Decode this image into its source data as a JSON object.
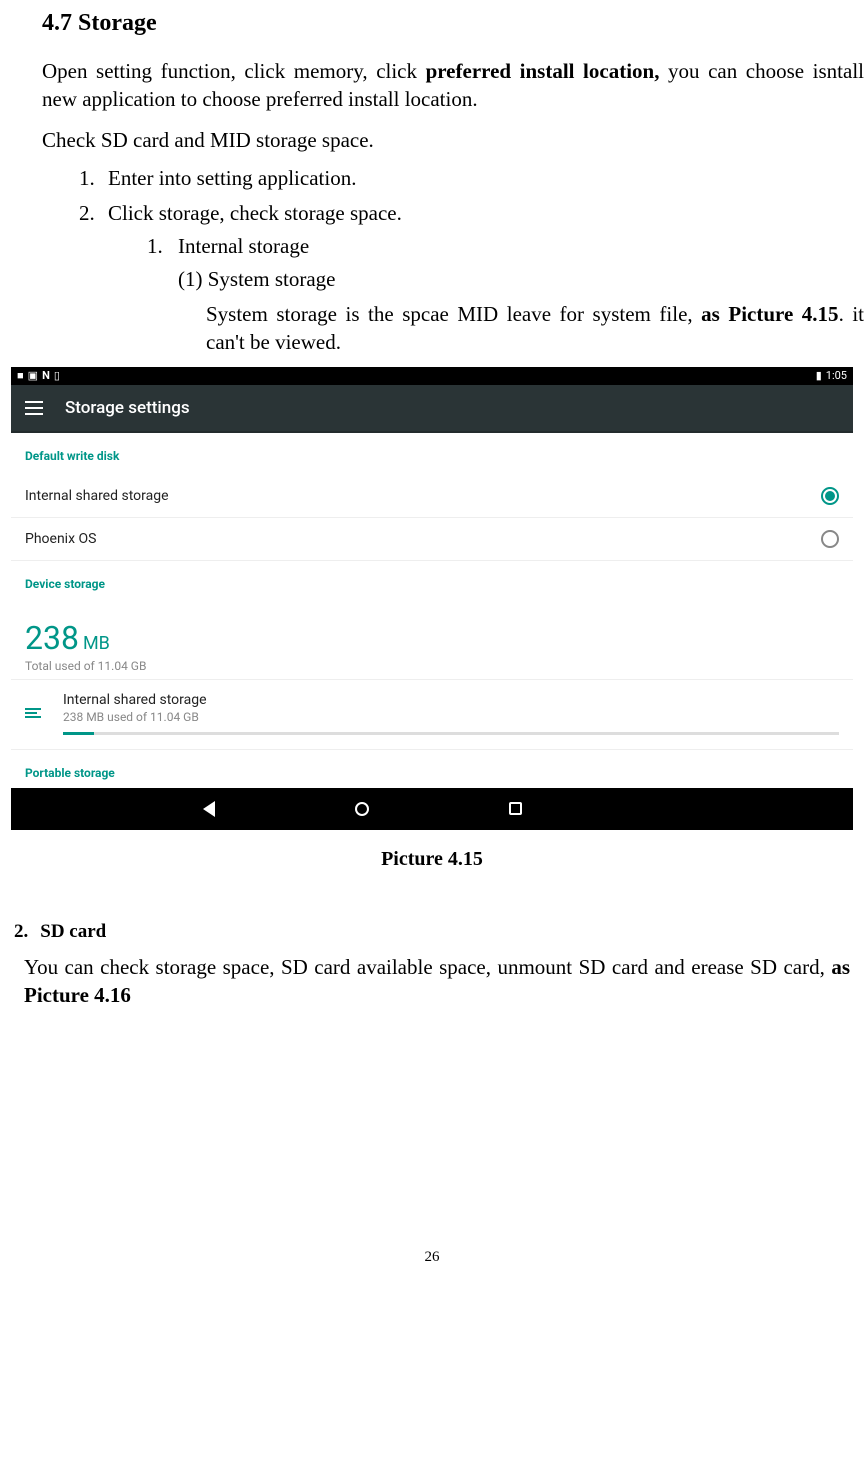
{
  "doc": {
    "section_number": "4.7",
    "section_title": "Storage",
    "open_para_pre": "Open setting function, click memory, click ",
    "open_para_bold": "preferred install location,",
    "open_para_post": " you can choose isntall new application to choose preferred install location.",
    "check_line": "Check SD card and MID storage space.",
    "steps": [
      "Enter into setting application.",
      "Click storage, check storage space."
    ],
    "internal_storage_label": "Internal storage",
    "sys_storage_label": "(1) System storage",
    "sys_storage_desc_pre": "System storage is the spcae MID leave for system file, ",
    "sys_storage_desc_bold": "as Picture 4.15",
    "sys_storage_desc_post": ". it can't be viewed.",
    "caption": "Picture 4.15",
    "sd_num": "2.",
    "sd_title": "SD card",
    "sd_para_pre": "You can check storage space, SD card available space, unmount SD card and erease SD card, ",
    "sd_para_bold": "as Picture 4.16",
    "page_number": "26"
  },
  "shot": {
    "status": {
      "time": "1:05",
      "icons": [
        "square-fill",
        "image",
        "n-icon",
        "sim-icon"
      ]
    },
    "app_title": "Storage settings",
    "section_default": "Default write disk",
    "options": [
      {
        "label": "Internal shared storage",
        "selected": true
      },
      {
        "label": "Phoenix OS",
        "selected": false
      }
    ],
    "section_device": "Device storage",
    "usage_value": "238",
    "usage_unit": "MB",
    "usage_total": "Total used of 11.04 GB",
    "item": {
      "name": "Internal shared storage",
      "detail": "238 MB used of 11.04 GB"
    },
    "section_portable": "Portable storage"
  }
}
